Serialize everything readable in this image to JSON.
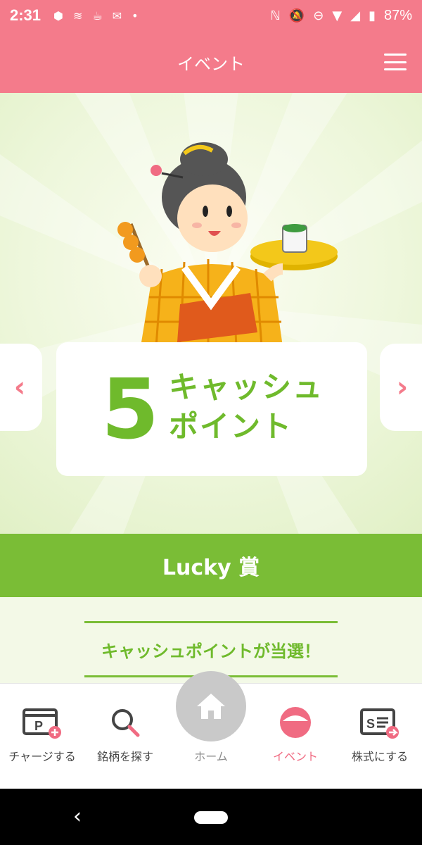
{
  "status_bar": {
    "time": "2:31",
    "battery": "87%"
  },
  "header": {
    "title": "イベント"
  },
  "prize": {
    "number": "5",
    "line1": "キャッシュ",
    "line2": "ポイント",
    "prev_arrow": "‹",
    "next_arrow": "›"
  },
  "result": {
    "title": "Lucky 賞",
    "message": "キャッシュポイントが当選！"
  },
  "bottom_nav": {
    "items": [
      {
        "label": "チャージする",
        "icon": "charge-icon"
      },
      {
        "label": "銘柄を探す",
        "icon": "search-icon"
      },
      {
        "label": "ホーム",
        "icon": "home-icon"
      },
      {
        "label": "イベント",
        "icon": "event-icon",
        "active": true
      },
      {
        "label": "株式にする",
        "icon": "stock-icon"
      }
    ]
  },
  "colors": {
    "brand_pink": "#f47b8b",
    "accent_green": "#7abd36",
    "prize_green": "#6fba2c"
  }
}
